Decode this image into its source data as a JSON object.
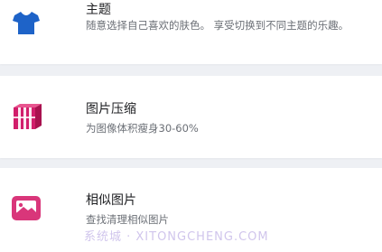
{
  "colors": {
    "theme_icon": "#1e63c8",
    "compress_icon": "#d11e6b",
    "similar_icon": "#d9367a",
    "background": "#eef0f4"
  },
  "items": [
    {
      "icon": "tshirt-icon",
      "title": "主题",
      "description": "随意选择自己喜欢的肤色。 享受切换到不同主题的乐趣。"
    },
    {
      "icon": "compress-image-icon",
      "title": "图片压缩",
      "description": "为图像体积瘦身30-60%"
    },
    {
      "icon": "similar-image-icon",
      "title": "相似图片",
      "description": "查找清理相似图片"
    }
  ],
  "watermark": "系统城 · XITONGCHENG.COM"
}
